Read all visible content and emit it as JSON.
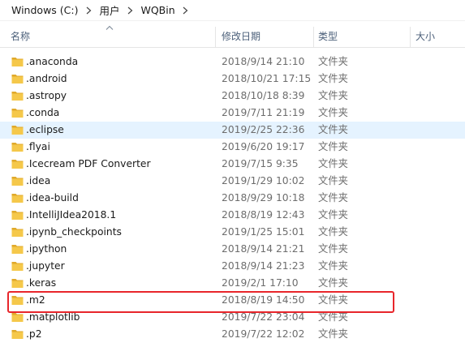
{
  "breadcrumb": {
    "items": [
      "Windows (C:)",
      "用户",
      "WQBin"
    ]
  },
  "columns": {
    "name": "名称",
    "date": "修改日期",
    "type": "类型",
    "size": "大小"
  },
  "files": [
    {
      "name": ".anaconda",
      "date": "2018/9/14 21:10",
      "type": "文件夹"
    },
    {
      "name": ".android",
      "date": "2018/10/21 17:15",
      "type": "文件夹"
    },
    {
      "name": ".astropy",
      "date": "2018/10/18 8:39",
      "type": "文件夹"
    },
    {
      "name": ".conda",
      "date": "2019/7/11 21:19",
      "type": "文件夹"
    },
    {
      "name": ".eclipse",
      "date": "2019/2/25 22:36",
      "type": "文件夹",
      "hover": true
    },
    {
      "name": ".flyai",
      "date": "2019/6/20 19:17",
      "type": "文件夹"
    },
    {
      "name": ".Icecream PDF Converter",
      "date": "2019/7/15 9:35",
      "type": "文件夹"
    },
    {
      "name": ".idea",
      "date": "2019/1/29 10:02",
      "type": "文件夹"
    },
    {
      "name": ".idea-build",
      "date": "2018/9/29 10:18",
      "type": "文件夹"
    },
    {
      "name": ".IntelliJIdea2018.1",
      "date": "2018/8/19 12:43",
      "type": "文件夹"
    },
    {
      "name": ".ipynb_checkpoints",
      "date": "2019/1/25 15:01",
      "type": "文件夹"
    },
    {
      "name": ".ipython",
      "date": "2018/9/14 21:21",
      "type": "文件夹"
    },
    {
      "name": ".jupyter",
      "date": "2018/9/14 21:23",
      "type": "文件夹"
    },
    {
      "name": ".keras",
      "date": "2019/2/1 17:10",
      "type": "文件夹"
    },
    {
      "name": ".m2",
      "date": "2018/8/19 14:50",
      "type": "文件夹",
      "highlighted": true
    },
    {
      "name": ".matplotlib",
      "date": "2019/7/22 23:04",
      "type": "文件夹"
    },
    {
      "name": ".p2",
      "date": "2019/7/22 12:02",
      "type": "文件夹"
    }
  ],
  "colors": {
    "folder": "#f5c84a",
    "folder_dark": "#e0a92a",
    "hover": "#e5f3ff",
    "highlight_box": "#e8262b",
    "header_text": "#4c607a"
  }
}
